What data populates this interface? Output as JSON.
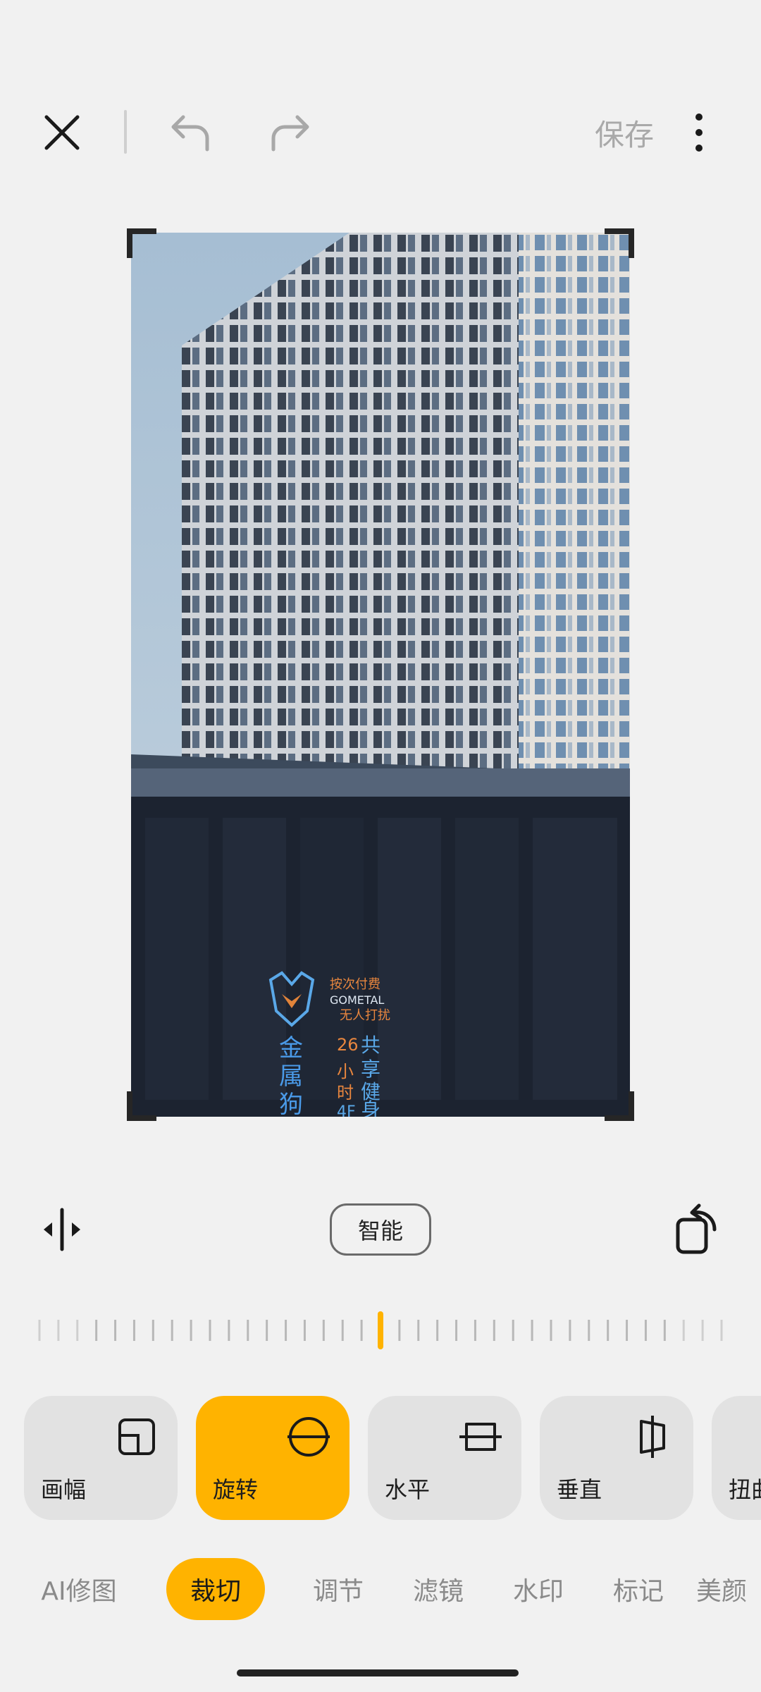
{
  "topbar": {
    "close_icon": "close-icon",
    "undo_icon": "undo-icon",
    "redo_icon": "redo-icon",
    "save_label": "保存",
    "more_icon": "more-vertical-icon"
  },
  "photo": {
    "sign_text_1": "按次付费",
    "sign_text_2": "GOMETAL",
    "sign_text_3": "无人打扰",
    "sign_text_4": "金属狗",
    "sign_text_5": "26小时4F",
    "sign_text_6": "共享健身"
  },
  "controls": {
    "flip_icon": "flip-horizontal-icon",
    "smart_label": "智能",
    "rotate_icon": "rotate-icon"
  },
  "ruler": {
    "level": 0.5
  },
  "tools": [
    {
      "label": "画幅",
      "icon": "aspect-ratio-icon",
      "active": false
    },
    {
      "label": "旋转",
      "icon": "rotate-straighten-icon",
      "active": true
    },
    {
      "label": "水平",
      "icon": "horizontal-perspective-icon",
      "active": false
    },
    {
      "label": "垂直",
      "icon": "vertical-perspective-icon",
      "active": false
    },
    {
      "label": "扭曲",
      "icon": "distort-icon",
      "active": false
    }
  ],
  "tabs": [
    {
      "label": "AI修图",
      "active": false
    },
    {
      "label": "裁切",
      "active": true
    },
    {
      "label": "调节",
      "active": false
    },
    {
      "label": "滤镜",
      "active": false
    },
    {
      "label": "水印",
      "active": false
    },
    {
      "label": "标记",
      "active": false
    },
    {
      "label": "美颜",
      "active": false
    }
  ],
  "colors": {
    "accent": "#ffb300",
    "background": "#f1f1f1"
  }
}
